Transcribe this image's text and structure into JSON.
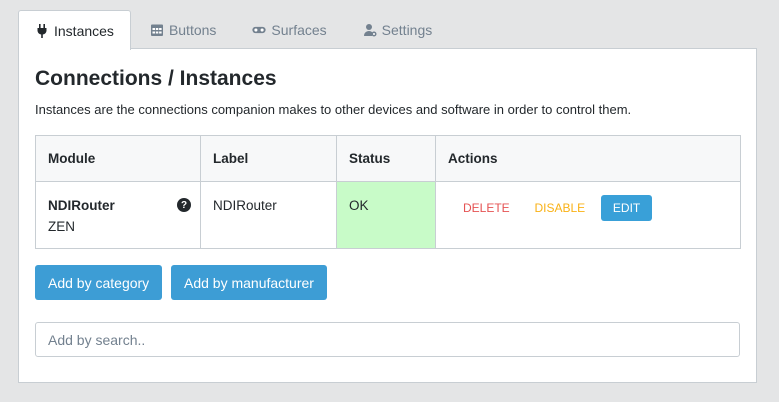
{
  "tabs": [
    {
      "label": "Instances",
      "icon": "plug-icon",
      "active": true
    },
    {
      "label": "Buttons",
      "icon": "calendar-grid-icon",
      "active": false
    },
    {
      "label": "Surfaces",
      "icon": "gamepad-icon",
      "active": false
    },
    {
      "label": "Settings",
      "icon": "user-cog-icon",
      "active": false
    }
  ],
  "page": {
    "title": "Connections / Instances",
    "description": "Instances are the connections companion makes to other devices and software in order to control them."
  },
  "table": {
    "headers": [
      "Module",
      "Label",
      "Status",
      "Actions"
    ],
    "rows": [
      {
        "module": "NDIRouter",
        "manufacturer": "ZEN",
        "help": "?",
        "label": "NDIRouter",
        "status": "OK",
        "actions": {
          "delete": "DELETE",
          "disable": "DISABLE",
          "edit": "EDIT"
        }
      }
    ]
  },
  "buttons": {
    "add_by_category": "Add by category",
    "add_by_manufacturer": "Add by manufacturer"
  },
  "search": {
    "placeholder": "Add by search..",
    "value": ""
  },
  "colors": {
    "status_ok_bg": "#c8fbc8",
    "primary": "#3d9dd5",
    "danger": "#e55353",
    "warning": "#f9b115"
  }
}
